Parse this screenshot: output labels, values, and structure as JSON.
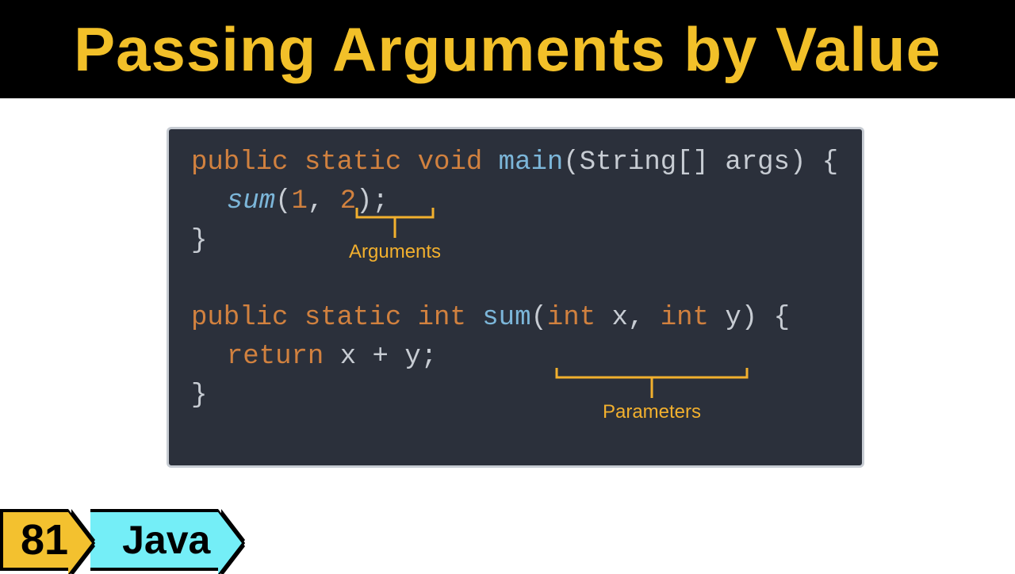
{
  "header": {
    "title": "Passing Arguments by Value"
  },
  "code": {
    "line1": {
      "kw": "public static void ",
      "name": "main",
      "rest1": "(String[] args) {"
    },
    "line2": {
      "call": "sum",
      "paren_open": "(",
      "arg1": "1",
      "comma": ", ",
      "arg2": "2",
      "paren_close": ");"
    },
    "line3": {
      "brace": "}"
    },
    "line4": {
      "kw": "public static int ",
      "name": "sum",
      "paren_open": "(",
      "t1": "int ",
      "p1": "x",
      "comma": ", ",
      "t2": "int ",
      "p2": "y",
      "paren_close": ") {"
    },
    "line5": {
      "kw": "return ",
      "expr": "x + y;"
    },
    "line6": {
      "brace": "}"
    }
  },
  "annotations": {
    "args": "Arguments",
    "params": "Parameters"
  },
  "footer": {
    "number": "81",
    "language": "Java"
  }
}
